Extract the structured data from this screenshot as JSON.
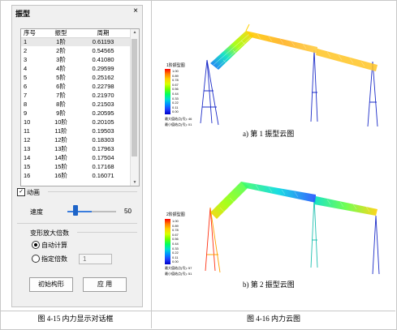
{
  "dialog": {
    "title": "振型",
    "close_label": "×",
    "columns": [
      "序号",
      "振型",
      "周期"
    ],
    "rows": [
      [
        "1",
        "1阶",
        "0.61193"
      ],
      [
        "2",
        "2阶",
        "0.54565"
      ],
      [
        "3",
        "3阶",
        "0.41080"
      ],
      [
        "4",
        "4阶",
        "0.29599"
      ],
      [
        "5",
        "5阶",
        "0.25162"
      ],
      [
        "6",
        "6阶",
        "0.22798"
      ],
      [
        "7",
        "7阶",
        "0.21970"
      ],
      [
        "8",
        "8阶",
        "0.21503"
      ],
      [
        "9",
        "9阶",
        "0.20595"
      ],
      [
        "10",
        "10阶",
        "0.20105"
      ],
      [
        "11",
        "11阶",
        "0.19503"
      ],
      [
        "12",
        "12阶",
        "0.18303"
      ],
      [
        "13",
        "13阶",
        "0.17963"
      ],
      [
        "14",
        "14阶",
        "0.17504"
      ],
      [
        "15",
        "15阶",
        "0.17168"
      ],
      [
        "16",
        "16阶",
        "0.16071"
      ]
    ],
    "animation": {
      "label": "动画",
      "checked": true
    },
    "speed": {
      "label": "速度",
      "value": "50",
      "fraction": 0.5
    },
    "scale_group": {
      "label": "变形放大倍数",
      "auto_label": "自动计算",
      "manual_label": "指定倍数",
      "manual_value": "1",
      "selected": "auto"
    },
    "buttons": {
      "initial": "初始构形",
      "apply": "应 用"
    }
  },
  "captions": {
    "left": "图 4-15    内力显示对话框",
    "right": "图 4-16    内力云图"
  },
  "figures": [
    {
      "subcaption": "a)  第 1 振型云图",
      "legend_title": "1阶振型图",
      "legend_values": [
        "1.00",
        "0.89",
        "0.78",
        "0.67",
        "0.56",
        "0.44",
        "0.33",
        "0.22",
        "0.11",
        "0.00"
      ],
      "legend_notes": [
        "最大值结点(号): 46",
        "最小值结点(号): 01"
      ]
    },
    {
      "subcaption": "b)  第 2 振型云图",
      "legend_title": "2阶振型图",
      "legend_values": [
        "1.00",
        "0.89",
        "0.78",
        "0.67",
        "0.56",
        "0.44",
        "0.33",
        "0.22",
        "0.11",
        "0.00"
      ],
      "legend_notes": [
        "最大值结点(号): 57",
        "最小值结点(号): 51"
      ]
    }
  ],
  "colors": {
    "legend_scale": [
      "#ff0000",
      "#ff8000",
      "#ffd000",
      "#d8ff00",
      "#70ff00",
      "#00ff60",
      "#00e0d0",
      "#0090ff",
      "#2040ff",
      "#0000c8"
    ],
    "structure_blue": "#1c2cc8",
    "slider": "#1e64c8"
  }
}
